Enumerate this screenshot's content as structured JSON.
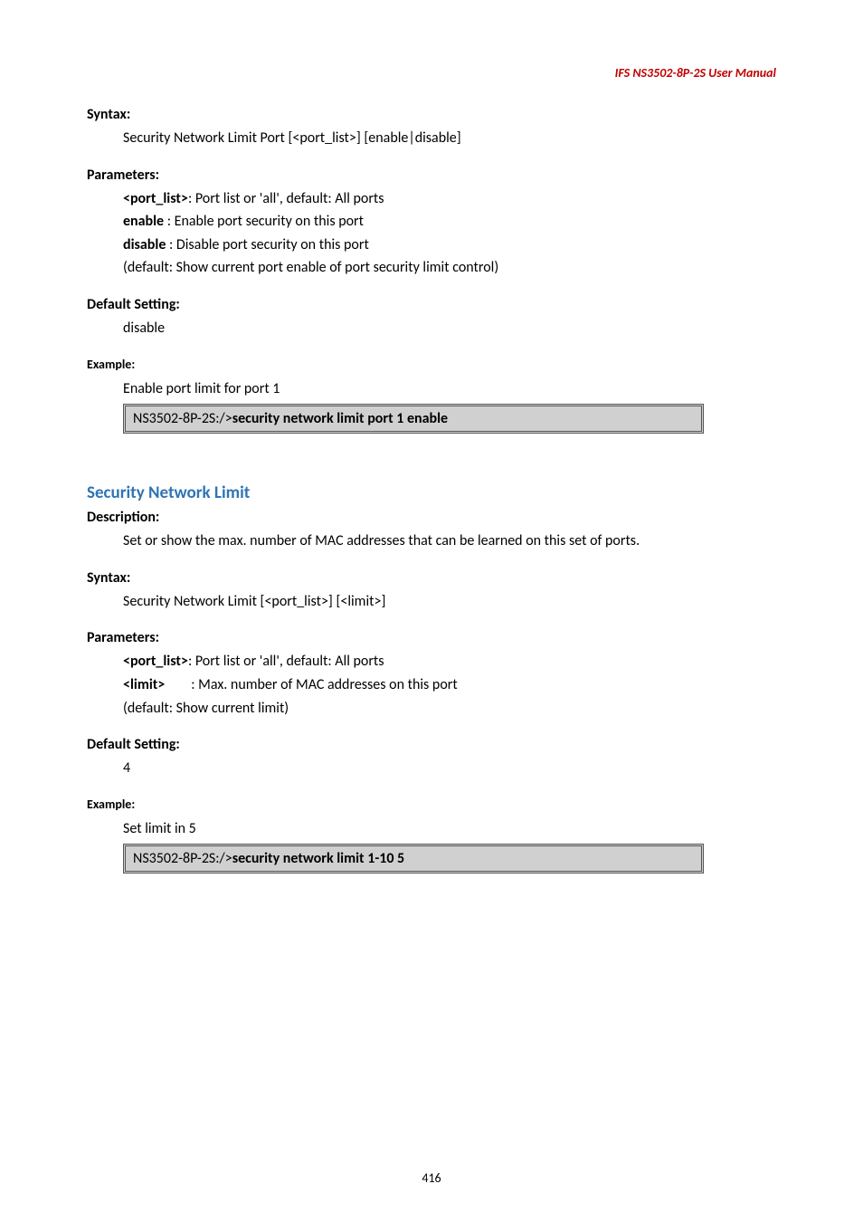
{
  "header": {
    "product": "IFS  NS3502-8P-2S  User  Manual"
  },
  "sec1": {
    "syntax_label": "Syntax:",
    "syntax_text": "Security Network Limit Port [<port_list>] [enable|disable]",
    "params_label": "Parameters:",
    "param_portlist_key": "<port_list>",
    "param_portlist_desc": ": Port list or 'all', default: All ports",
    "param_enable_key": "enable",
    "param_enable_desc": "    : Enable port security on this port",
    "param_disable_key": "disable",
    "param_disable_desc": " : Disable port security on this port",
    "param_default": "(default: Show current port enable of port security limit control)",
    "default_label": "Default Setting:",
    "default_value": "disable",
    "example_label": "Example:",
    "example_desc": "Enable port limit for port 1",
    "cmd_prefix": "NS3502-8P-2S:/>",
    "cmd_bold": "security network limit port 1 enable"
  },
  "sec2": {
    "title": "Security Network Limit",
    "desc_label": "Description:",
    "desc_text": "Set or show the max. number of MAC addresses that can be learned on this set of ports.",
    "syntax_label": "Syntax:",
    "syntax_text": "Security Network Limit [<port_list>] [<limit>]",
    "params_label": "Parameters:",
    "param_portlist_key": "<port_list>",
    "param_portlist_desc": ": Port list or 'all', default: All ports",
    "param_limit_key": "<limit>",
    "param_limit_desc": "        : Max. number of MAC addresses on this port",
    "param_default": "(default: Show current limit)",
    "default_label": "Default Setting:",
    "default_value": "4",
    "example_label": "Example:",
    "example_desc": "Set limit in 5",
    "cmd_prefix": "NS3502-8P-2S:/>",
    "cmd_bold": "security network limit 1-10 5"
  },
  "footer": {
    "page": "416"
  }
}
